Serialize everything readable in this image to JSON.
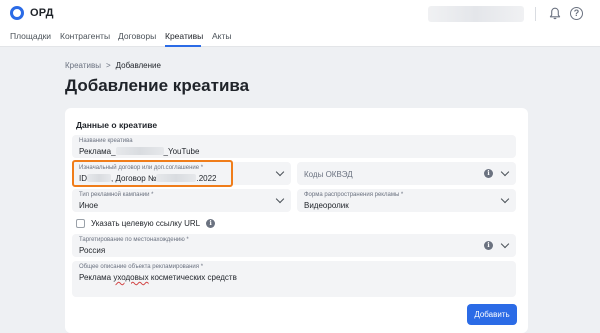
{
  "app": {
    "logo_text": "ОРД"
  },
  "nav": {
    "items": [
      {
        "label": "Площадки"
      },
      {
        "label": "Контрагенты"
      },
      {
        "label": "Договоры"
      },
      {
        "label": "Креативы"
      },
      {
        "label": "Акты"
      }
    ],
    "active": "Креативы"
  },
  "header": {
    "help_glyph": "?"
  },
  "breadcrumb": {
    "parent": "Креативы",
    "separator": ">",
    "current": "Добавление"
  },
  "page": {
    "title": "Добавление креатива"
  },
  "form": {
    "section_title": "Данные о креативе",
    "creative_name": {
      "label": "Название креатива",
      "value_prefix": "Реклама_",
      "value_suffix": "_YouTube"
    },
    "original_contract": {
      "label": "Изначальный договор или доп.соглашение *",
      "value_prefix": "ID",
      "value_middle": ", Договор №",
      "value_suffix": ".2022"
    },
    "okved": {
      "placeholder": "Коды ОКВЭД"
    },
    "campaign_type": {
      "label": "Тип рекламной кампании *",
      "value": "Иное"
    },
    "distribution_form": {
      "label": "Форма распространения рекламы *",
      "value": "Видеоролик"
    },
    "target_url": {
      "label": "Указать целевую ссылку URL",
      "checked": false
    },
    "geo_targeting": {
      "label": "Таргетирование по местонахождению *",
      "value": "Россия"
    },
    "description": {
      "label": "Общее описание объекта рекламирования *",
      "value_before": "Реклама ",
      "value_misspelled": "уходовых",
      "value_after": " косметических средств"
    },
    "submit_label": "Добавить"
  },
  "colors": {
    "accent": "#2b6be6",
    "highlight": "#f07d1a",
    "field_bg": "#f3f4f6",
    "page_bg": "#eef0f3"
  },
  "icons": {
    "logo": "ring-logo-icon",
    "bell": "bell-icon",
    "help": "help-circle-icon",
    "info": "info-icon",
    "chevron": "chevron-down-icon"
  }
}
